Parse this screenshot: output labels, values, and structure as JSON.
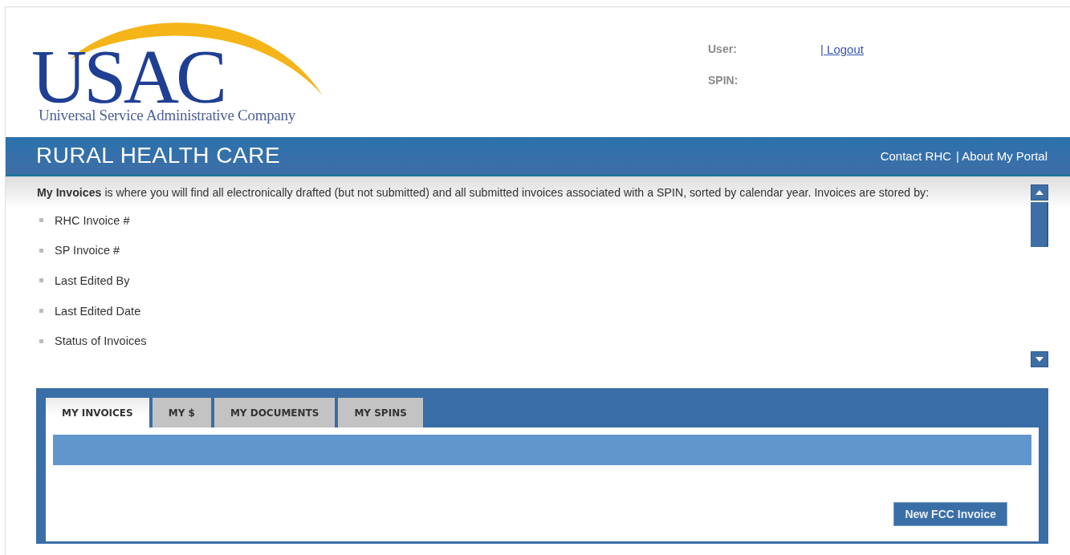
{
  "logo": {
    "wordmark": "USAC",
    "tagline": "Universal Service Administrative Company"
  },
  "user_info": [
    {
      "label": "User:",
      "link": "| Logout"
    },
    {
      "label": "SPIN:"
    }
  ],
  "banner": {
    "title": "RURAL HEALTH CARE",
    "links": [
      "Contact RHC",
      "| About My Portal"
    ]
  },
  "intro": {
    "text": "**My Invoices** is where you will find all electronically drafted (but not submitted) and all submitted invoices associated with a SPIN, sorted by calendar year. Invoices are stored by:",
    "items": [
      "RHC Invoice #",
      "SP Invoice #",
      "Last Edited By",
      "Last Edited Date",
      "Status of Invoices"
    ]
  },
  "tabs": [
    {
      "label": "MY INVOICES",
      "selected": true
    },
    {
      "label": "MY $",
      "selected": false
    },
    {
      "label": "MY DOCUMENTS",
      "selected": false
    },
    {
      "label": "MY SPINS",
      "selected": false
    }
  ],
  "buttons": [
    "New FCC Invoice"
  ]
}
